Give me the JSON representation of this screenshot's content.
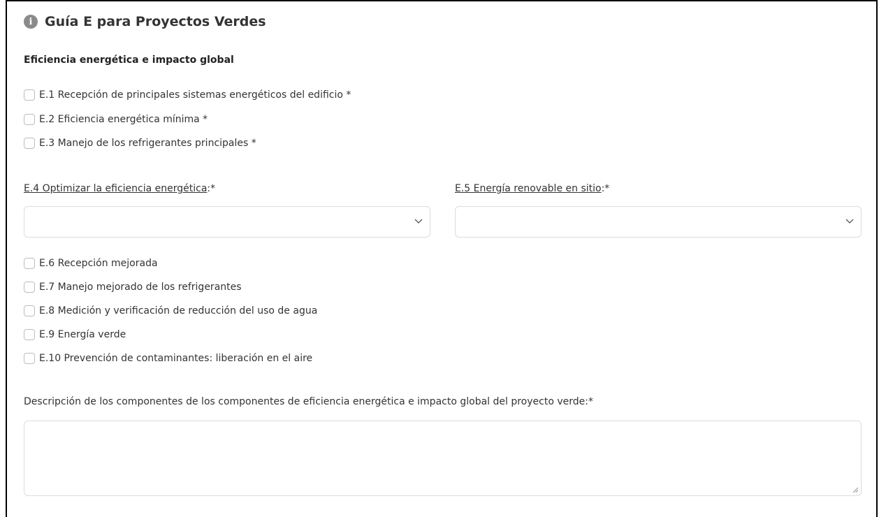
{
  "header": {
    "title": "Guía E para Proyectos Verdes",
    "icon": "info-icon"
  },
  "section": {
    "title": "Eficiencia energética e impacto global"
  },
  "prereqs": [
    {
      "label": "E.1 Recepción de principales sistemas energéticos del edificio *",
      "checked": false
    },
    {
      "label": "E.2 Eficiencia energética mínima *",
      "checked": false
    },
    {
      "label": "E.3 Manejo de los refrigerantes principales *",
      "checked": false
    }
  ],
  "selects": {
    "e4": {
      "label_link": "E.4 Optimizar la eficiencia energética",
      "label_suffix": ":*",
      "value": ""
    },
    "e5": {
      "label_link": "E.5 Energía renovable en sitio",
      "label_suffix": ":*",
      "value": ""
    }
  },
  "credits": [
    {
      "label": "E.6 Recepción mejorada",
      "checked": false
    },
    {
      "label": "E.7 Manejo mejorado de los refrigerantes",
      "checked": false
    },
    {
      "label": "E.8 Medición y verificación de reducción del uso de agua",
      "checked": false
    },
    {
      "label": "E.9 Energía verde",
      "checked": false
    },
    {
      "label": "E.10 Prevención de contaminantes: liberación en el aire",
      "checked": false
    }
  ],
  "description": {
    "label": "Descripción de los componentes de los componentes de eficiencia energética e impacto global del proyecto verde:*",
    "value": ""
  }
}
